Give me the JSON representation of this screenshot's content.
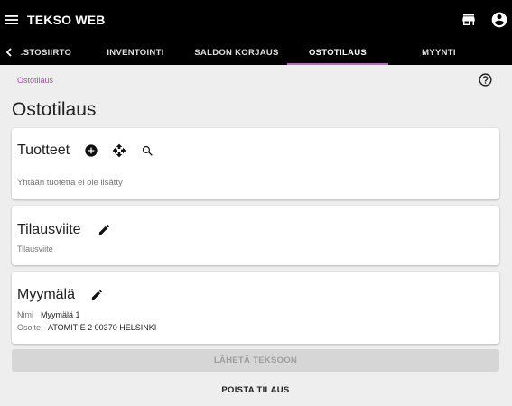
{
  "app": {
    "title": "TEKSO WEB"
  },
  "icons": {
    "menu": "menu-icon",
    "store": "store-icon",
    "account": "account-circle-icon",
    "chevron": "chevron-left-icon",
    "help": "help-circle-icon",
    "add": "add-circle-icon",
    "move": "move-icon",
    "search": "search-icon",
    "edit": "pencil-icon"
  },
  "tabs": [
    {
      "label": ".STOSIIRTO"
    },
    {
      "label": "INVENTOINTI"
    },
    {
      "label": "SALDON KORJAUS"
    },
    {
      "label": "OSTOTILAUS"
    },
    {
      "label": "MYYNTI"
    }
  ],
  "breadcrumb": "Ostotilaus",
  "page_title": "Ostotilaus",
  "products": {
    "title": "Tuotteet",
    "empty_text": "Yhtään tuotetta ei ole lisätty"
  },
  "order_ref": {
    "title": "Tilausviite",
    "placeholder": "Tilausviite"
  },
  "store": {
    "title": "Myymälä",
    "name_label": "Nimi",
    "name_value": "Myymälä 1",
    "address_label": "Osoite",
    "address_value": "ATOMITIE 2 00370 HELSINKI"
  },
  "actions": {
    "send": "LÄHETÄ TEKSOON",
    "delete": "POISTA TILAUS"
  },
  "colors": {
    "accent": "#ba68c8",
    "appbar": "#000000",
    "background": "#eeeeee"
  }
}
